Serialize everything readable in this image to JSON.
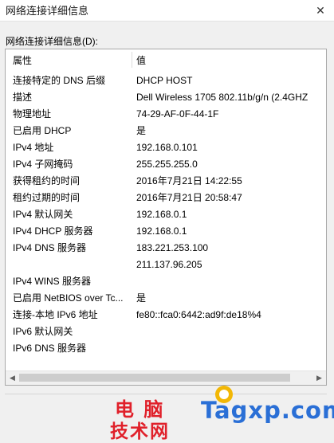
{
  "window": {
    "title": "网络连接详细信息",
    "close_glyph": "✕"
  },
  "details": {
    "label": "网络连接详细信息(D):",
    "columns": {
      "property": "属性",
      "value": "值"
    },
    "rows": [
      {
        "property": "连接特定的 DNS 后缀",
        "value": "DHCP HOST"
      },
      {
        "property": "描述",
        "value": "Dell Wireless 1705 802.11b/g/n (2.4GHZ"
      },
      {
        "property": "物理地址",
        "value": "74-29-AF-0F-44-1F"
      },
      {
        "property": "已启用 DHCP",
        "value": "是"
      },
      {
        "property": "IPv4 地址",
        "value": "192.168.0.101"
      },
      {
        "property": "IPv4 子网掩码",
        "value": "255.255.255.0"
      },
      {
        "property": "获得租约的时间",
        "value": "2016年7月21日 14:22:55"
      },
      {
        "property": "租约过期的时间",
        "value": "2016年7月21日 20:58:47"
      },
      {
        "property": "IPv4 默认网关",
        "value": "192.168.0.1"
      },
      {
        "property": "IPv4 DHCP 服务器",
        "value": "192.168.0.1"
      },
      {
        "property": "IPv4 DNS 服务器",
        "value": "183.221.253.100"
      },
      {
        "property": "",
        "value": "211.137.96.205"
      },
      {
        "property": "IPv4 WINS 服务器",
        "value": ""
      },
      {
        "property": "已启用 NetBIOS over Tc...",
        "value": "是"
      },
      {
        "property": "连接-本地 IPv6 地址",
        "value": "fe80::fca0:6442:ad9f:de18%4"
      },
      {
        "property": "IPv6 默认网关",
        "value": ""
      },
      {
        "property": "IPv6 DNS 服务器",
        "value": ""
      }
    ],
    "scrollbar": {
      "left_glyph": "◀",
      "right_glyph": "▶"
    }
  },
  "watermark": {
    "line1": "电 脑",
    "line2": "技术网",
    "site": "Tagxp.com",
    "colors": {
      "cn": "#e0202a",
      "site": "#2a6fd6",
      "badge": "#f2b705"
    }
  }
}
